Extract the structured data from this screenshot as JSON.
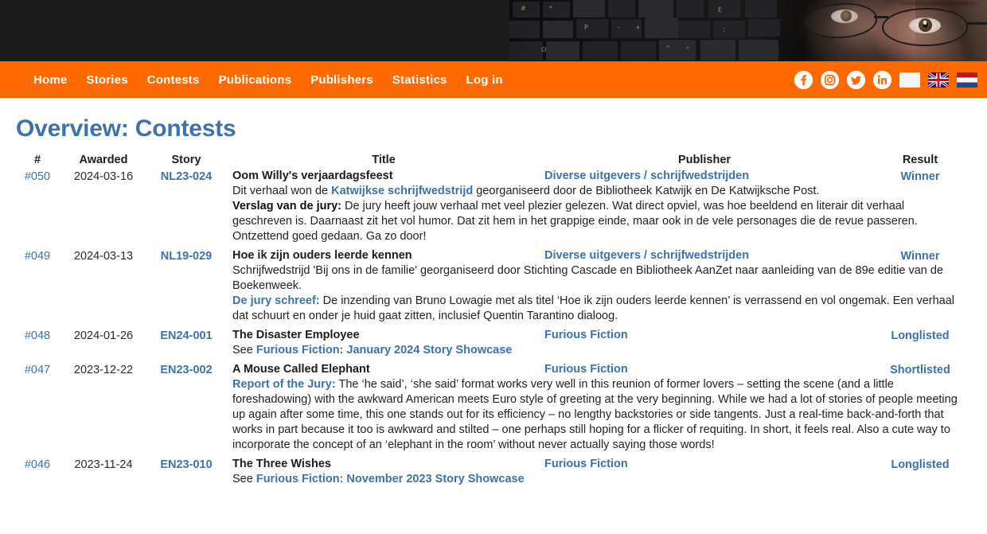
{
  "banner": {
    "alt": "Close-up photo of a person with glasses behind a laptop keyboard"
  },
  "nav": {
    "links": [
      {
        "label": "Home"
      },
      {
        "label": "Stories"
      },
      {
        "label": "Contests"
      },
      {
        "label": "Publications"
      },
      {
        "label": "Publishers"
      },
      {
        "label": "Statistics"
      },
      {
        "label": "Log in"
      }
    ],
    "icons": [
      {
        "name": "facebook-icon"
      },
      {
        "name": "instagram-icon"
      },
      {
        "name": "twitter-icon"
      },
      {
        "name": "linkedin-icon"
      },
      {
        "name": "blank-flag-icon"
      },
      {
        "name": "flag-uk-icon"
      },
      {
        "name": "flag-nl-icon"
      }
    ],
    "background_color": "#ff6a00",
    "text_color": "#ffffff"
  },
  "page": {
    "title": "Overview: Contests",
    "title_color": "#3c72ad",
    "link_color": "#3c72ad"
  },
  "table": {
    "headers": {
      "num": "#",
      "awarded": "Awarded",
      "story": "Story",
      "title": "Title",
      "publisher": "Publisher",
      "result": "Result"
    },
    "rows": [
      {
        "num": "#050",
        "awarded": "2024-03-16",
        "story": "NL23-024",
        "title": "Oom Willy's verjaardagsfeest",
        "publisher": "Diverse uitgevers / schrijfwedstrijden",
        "result": "Winner",
        "desc_p1_pre": "Dit verhaal won de ",
        "desc_p1_link": "Katwijkse schrijfwedstrijd",
        "desc_p1_post": " georganiseerd door de Bibliotheek Katwijk en De Katwijksche Post.",
        "desc_p2_label": "Verslag van de jury:",
        "desc_p2_label_style": "bold-dark",
        "desc_p2_text": " De jury heeft jouw verhaal met veel plezier gelezen. Wat direct opviel, was hoe beeldend en literair dit verhaal geschreven is. Daarnaast zit het vol humor. Dat zit hem in het grappige einde, maar ook in de vele personages die de revue passeren. Ontzettend goed gedaan. Ga zo door!"
      },
      {
        "num": "#049",
        "awarded": "2024-03-13",
        "story": "NL19-029",
        "title": "Hoe ik zijn ouders leerde kennen",
        "publisher": "Diverse uitgevers / schrijfwedstrijden",
        "result": "Winner",
        "desc_p1_pre": "Schrijfwedstrijd 'Bij ons in de familie' georganiseerd door Stichting Cascade en Bibliotheek AanZet naar aanleiding van de 89e editie van de Boekenweek.",
        "desc_p1_link": "",
        "desc_p1_post": "",
        "desc_p2_label": "De jury schreef:",
        "desc_p2_label_style": "bold-blue",
        "desc_p2_text": " De inzending van Bruno Lowagie met als titel ‘Hoe ik zijn ouders leerde kennen’ is verrassend en vol ongemak. Een verhaal dat schuurt en onder je huid gaat zitten, inclusief Quentin Tarantino dialoog."
      },
      {
        "num": "#048",
        "awarded": "2024-01-26",
        "story": "EN24-001",
        "title": "The Disaster Employee",
        "publisher": "Furious Fiction",
        "result": "Longlisted",
        "see_prefix": "See ",
        "see_link": "Furious Fiction: January 2024 Story Showcase"
      },
      {
        "num": "#047",
        "awarded": "2023-12-22",
        "story": "EN23-002",
        "title": "A Mouse Called Elephant",
        "publisher": "Furious Fiction",
        "result": "Shortlisted",
        "desc_p2_label": "Report of the Jury:",
        "desc_p2_label_style": "bold-blue",
        "desc_p2_text": " The ‘he said’, ‘she said’ format works very well in this reunion of former lovers – setting the scene (and a little foreshadowing) with the awkward American meets Euro style of greeting at the very beginning. While we had a lot of stories of people meeting up again after some time, this one stands out for its efficiency – no lengthy backstories or side tangents. Just a real-time back-and-forth that works in part because it too is awkward and stilted – one perhaps still hoping for a flicker of requiting. In short, it feels real. Also a cute way to incorporate the concept of an ‘elephant in the room’ without never actually saying those words!"
      },
      {
        "num": "#046",
        "awarded": "2023-11-24",
        "story": "EN23-010",
        "title": "The Three Wishes",
        "publisher": "Furious Fiction",
        "result": "Longlisted",
        "see_prefix": "See ",
        "see_link": "Furious Fiction: November 2023 Story Showcase"
      }
    ]
  }
}
